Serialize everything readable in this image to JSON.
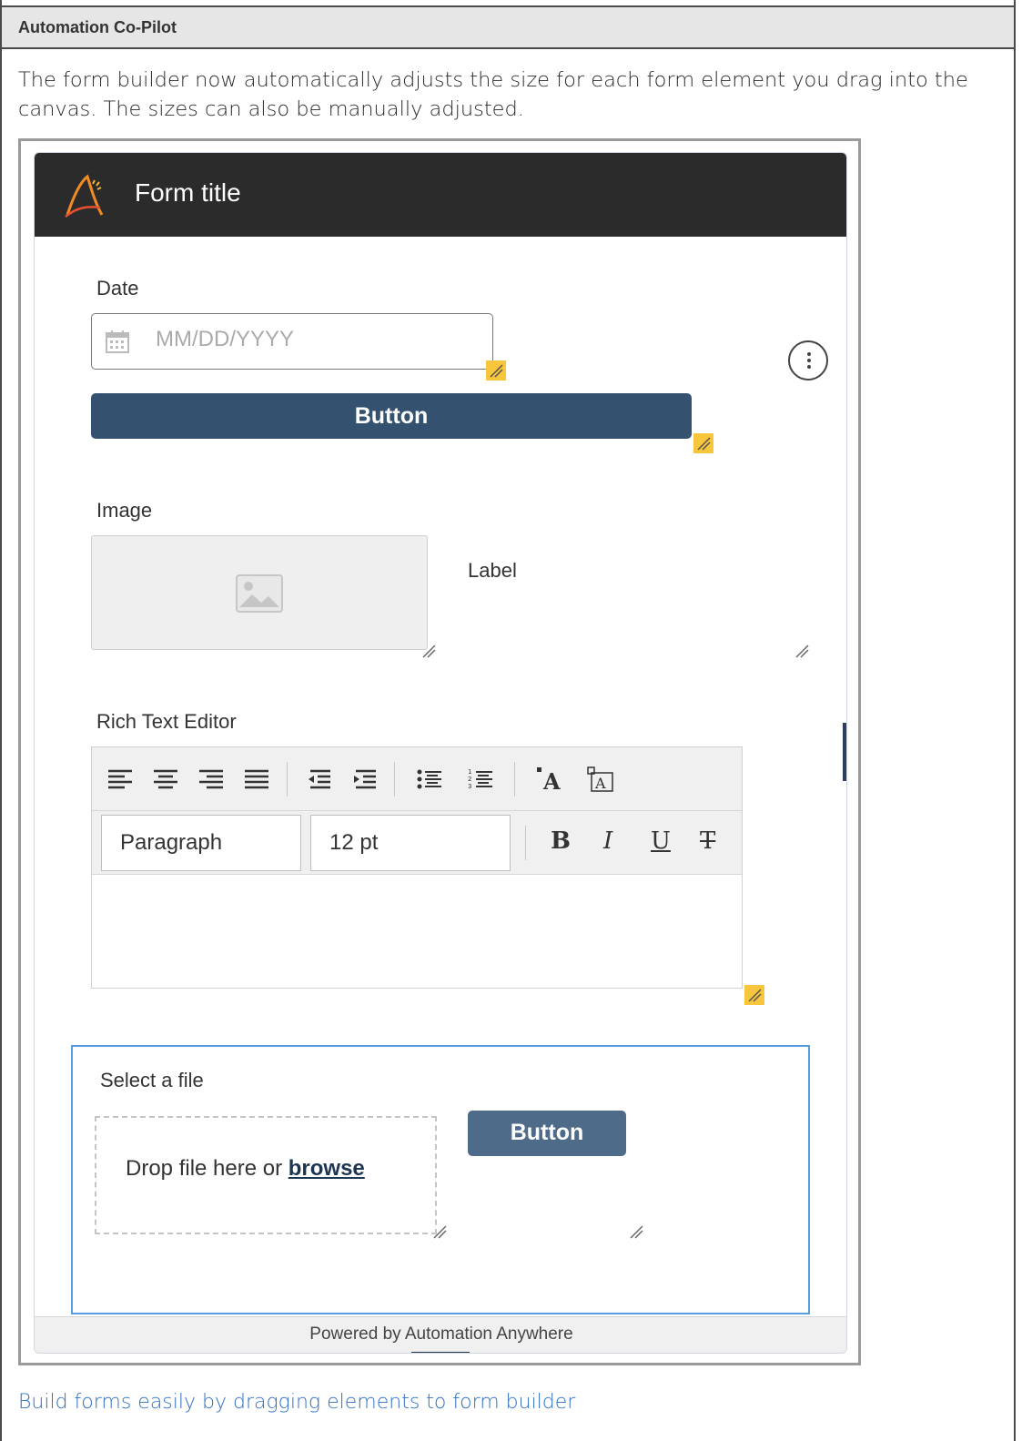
{
  "header": {
    "title": "Automation Co-Pilot"
  },
  "description": "The form builder now automatically adjusts the size for each form element you drag into the canvas. The sizes can also be manually adjusted.",
  "form": {
    "title": "Form title",
    "logo_icon": "automation-anywhere-logo",
    "date": {
      "label": "Date",
      "placeholder": "MM/DD/YYYY",
      "icon": "calendar-icon"
    },
    "more_icon": "vertical-ellipsis-icon",
    "button_label": "Button",
    "image": {
      "label": "Image",
      "icon": "image-placeholder-icon"
    },
    "label_element": "Label",
    "rich_text": {
      "label": "Rich Text Editor",
      "toolbar_icons": [
        "align-left-icon",
        "align-center-icon",
        "align-right-icon",
        "align-justify-icon",
        "outdent-icon",
        "indent-icon",
        "bullet-list-icon",
        "numbered-list-icon",
        "font-color-icon",
        "highlight-icon"
      ],
      "paragraph": "Paragraph",
      "font_size": "12 pt",
      "bold": "B",
      "italic": "I",
      "underline": "U",
      "strikethrough": "T"
    },
    "file": {
      "label": "Select a file",
      "drop_text": "Drop file here or ",
      "browse": "browse",
      "button_label": "Button"
    },
    "footer": "Powered by Automation Anywhere"
  },
  "caption": "Build forms easily by dragging elements to form builder",
  "colors": {
    "accent_yellow": "#f7c63d",
    "button_navy": "#34526f",
    "selection_blue": "#5b9be0",
    "link_blue": "#2f6fc7",
    "header_dark": "#2b2b2b"
  }
}
